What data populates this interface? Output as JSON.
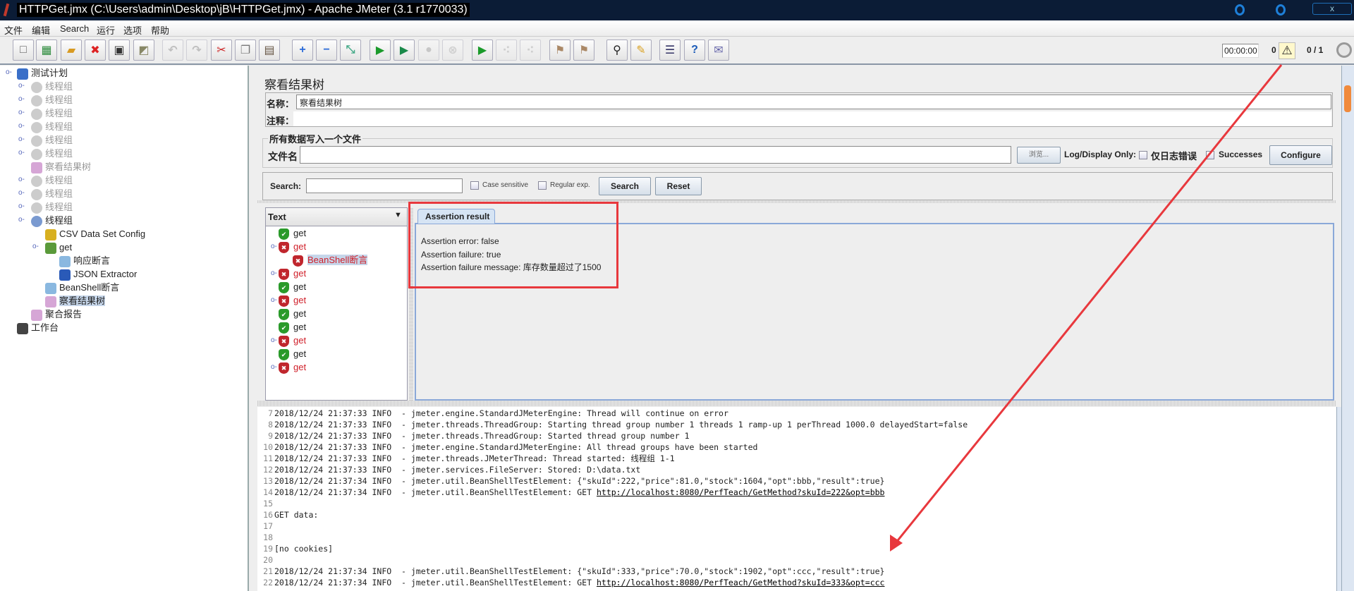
{
  "window": {
    "title": "HTTPGet.jmx (C:\\Users\\admin\\Desktop\\jB\\HTTPGet.jmx) - Apache JMeter (3.1 r1770033)",
    "close_label": "x"
  },
  "menu": [
    "文件",
    "编辑",
    "Search",
    "运行",
    "选项",
    "帮助"
  ],
  "toolbar": {
    "buttons": [
      "new-icon",
      "templates-icon",
      "open-icon",
      "close-icon",
      "save-icon",
      "save-as-image-icon",
      "undo-icon",
      "redo-icon",
      "cut-icon",
      "copy-icon",
      "paste-icon",
      "expand-all-icon",
      "collapse-all-icon",
      "toggle-icon",
      "start-icon",
      "start-no-pauses-icon",
      "stop-icon",
      "shutdown-icon",
      "remote-start-icon",
      "remote-stop-icon",
      "remote-exit-icon",
      "clear-icon",
      "clear-all-icon",
      "search-icon",
      "reset-search-icon",
      "function-helper-icon",
      "help-icon",
      "log-viewer-icon"
    ],
    "timer": "00:00:00",
    "error_count": "0",
    "threads": "0 / 1"
  },
  "tree": [
    {
      "label": "测试计划",
      "level": 0,
      "icon": "test-plan-icon",
      "state": "normal"
    },
    {
      "label": "线程组",
      "level": 1,
      "icon": "gear-icon",
      "state": "disabled"
    },
    {
      "label": "线程组",
      "level": 1,
      "icon": "gear-icon",
      "state": "disabled"
    },
    {
      "label": "线程组",
      "level": 1,
      "icon": "gear-icon",
      "state": "disabled"
    },
    {
      "label": "线程组",
      "level": 1,
      "icon": "gear-icon",
      "state": "disabled"
    },
    {
      "label": "线程组",
      "level": 1,
      "icon": "gear-icon",
      "state": "disabled"
    },
    {
      "label": "线程组",
      "level": 1,
      "icon": "gear-icon",
      "state": "disabled"
    },
    {
      "label": "察看结果树",
      "level": 1,
      "icon": "chart-icon",
      "state": "disabled"
    },
    {
      "label": "线程组",
      "level": 1,
      "icon": "gear-icon",
      "state": "disabled"
    },
    {
      "label": "线程组",
      "level": 1,
      "icon": "gear-icon",
      "state": "disabled"
    },
    {
      "label": "线程组",
      "level": 1,
      "icon": "gear-icon",
      "state": "disabled"
    },
    {
      "label": "线程组",
      "level": 1,
      "icon": "gear-icon",
      "state": "normal"
    },
    {
      "label": "CSV Data Set Config",
      "level": 2,
      "icon": "wrench-icon",
      "state": "normal"
    },
    {
      "label": "get",
      "level": 2,
      "icon": "pipette-icon",
      "state": "normal"
    },
    {
      "label": "响应断言",
      "level": 3,
      "icon": "magnifier-icon",
      "state": "normal"
    },
    {
      "label": "JSON Extractor",
      "level": 3,
      "icon": "arrow-icon",
      "state": "normal"
    },
    {
      "label": "BeanShell断言",
      "level": 2,
      "icon": "magnifier-icon",
      "state": "normal"
    },
    {
      "label": "察看结果树",
      "level": 2,
      "icon": "chart-icon",
      "state": "selected"
    },
    {
      "label": "聚合报告",
      "level": 1,
      "icon": "chart-icon",
      "state": "normal"
    },
    {
      "label": "工作台",
      "level": 0,
      "icon": "workbench-icon",
      "state": "normal"
    }
  ],
  "panel": {
    "title": "察看结果树",
    "name_label": "名称：",
    "name_value": "察看结果树",
    "comment_label": "注释：",
    "comment_value": "",
    "file_group": "所有数据写入一个文件",
    "file_label": "文件名",
    "file_value": "",
    "browse": "浏览...",
    "log_display_only": "Log/Display Only:",
    "errors_only": "仅日志错误",
    "errors_only_checked": false,
    "successes": "Successes",
    "successes_checked": false,
    "configure": "Configure",
    "search_label": "Search:",
    "search_value": "",
    "case_sensitive": "Case sensitive",
    "regular_exp": "Regular exp.",
    "search_btn": "Search",
    "reset_btn": "Reset"
  },
  "results": {
    "renderer": "Text",
    "items": [
      {
        "label": "get",
        "status": "success",
        "level": 0
      },
      {
        "label": "get",
        "status": "failure",
        "level": 0
      },
      {
        "label": "BeanShell断言",
        "status": "failure",
        "level": 1,
        "selected": true
      },
      {
        "label": "get",
        "status": "failure",
        "level": 0
      },
      {
        "label": "get",
        "status": "success",
        "level": 0
      },
      {
        "label": "get",
        "status": "failure",
        "level": 0
      },
      {
        "label": "get",
        "status": "success",
        "level": 0
      },
      {
        "label": "get",
        "status": "success",
        "level": 0
      },
      {
        "label": "get",
        "status": "failure",
        "level": 0
      },
      {
        "label": "get",
        "status": "success",
        "level": 0
      },
      {
        "label": "get",
        "status": "failure",
        "level": 0
      }
    ],
    "tab": "Assertion result",
    "assertion": [
      "Assertion error: false",
      "Assertion failure: true",
      "Assertion failure message: 库存数量超过了1500"
    ]
  },
  "log": [
    {
      "n": "7",
      "text": "2018/12/24 21:37:33 INFO  - jmeter.engine.StandardJMeterEngine: Thread will continue on error"
    },
    {
      "n": "8",
      "text": "2018/12/24 21:37:33 INFO  - jmeter.threads.ThreadGroup: Starting thread group number 1 threads 1 ramp-up 1 perThread 1000.0 delayedStart=false"
    },
    {
      "n": "9",
      "text": "2018/12/24 21:37:33 INFO  - jmeter.threads.ThreadGroup: Started thread group number 1"
    },
    {
      "n": "10",
      "text": "2018/12/24 21:37:33 INFO  - jmeter.engine.StandardJMeterEngine: All thread groups have been started"
    },
    {
      "n": "11",
      "text": "2018/12/24 21:37:33 INFO  - jmeter.threads.JMeterThread: Thread started: 线程组 1-1"
    },
    {
      "n": "12",
      "text": "2018/12/24 21:37:33 INFO  - jmeter.services.FileServer: Stored: D:\\data.txt"
    },
    {
      "n": "13",
      "text": "2018/12/24 21:37:34 INFO  - jmeter.util.BeanShellTestElement: {\"skuId\":222,\"price\":81.0,\"stock\":1604,\"opt\":bbb,\"result\":true}"
    },
    {
      "n": "14",
      "text": "2018/12/24 21:37:34 INFO  - jmeter.util.BeanShellTestElement: GET ",
      "link": "http://localhost:8080/PerfTeach/GetMethod?skuId=222&opt=bbb"
    },
    {
      "n": "15",
      "text": ""
    },
    {
      "n": "16",
      "text": "GET data:"
    },
    {
      "n": "17",
      "text": ""
    },
    {
      "n": "18",
      "text": ""
    },
    {
      "n": "19",
      "text": "[no cookies]"
    },
    {
      "n": "20",
      "text": ""
    },
    {
      "n": "21",
      "text": "2018/12/24 21:37:34 INFO  - jmeter.util.BeanShellTestElement: {\"skuId\":333,\"price\":70.0,\"stock\":1902,\"opt\":ccc,\"result\":true}"
    },
    {
      "n": "22",
      "text": "2018/12/24 21:37:34 INFO  - jmeter.util.BeanShellTestElement: GET ",
      "link": "http://localhost:8080/PerfTeach/GetMethod?skuId=333&opt=ccc"
    }
  ],
  "colors": {
    "annotation": "#e8383d",
    "failure": "#d0202a",
    "success": "#2a9a2a",
    "titlebar": "#0b1c36"
  }
}
